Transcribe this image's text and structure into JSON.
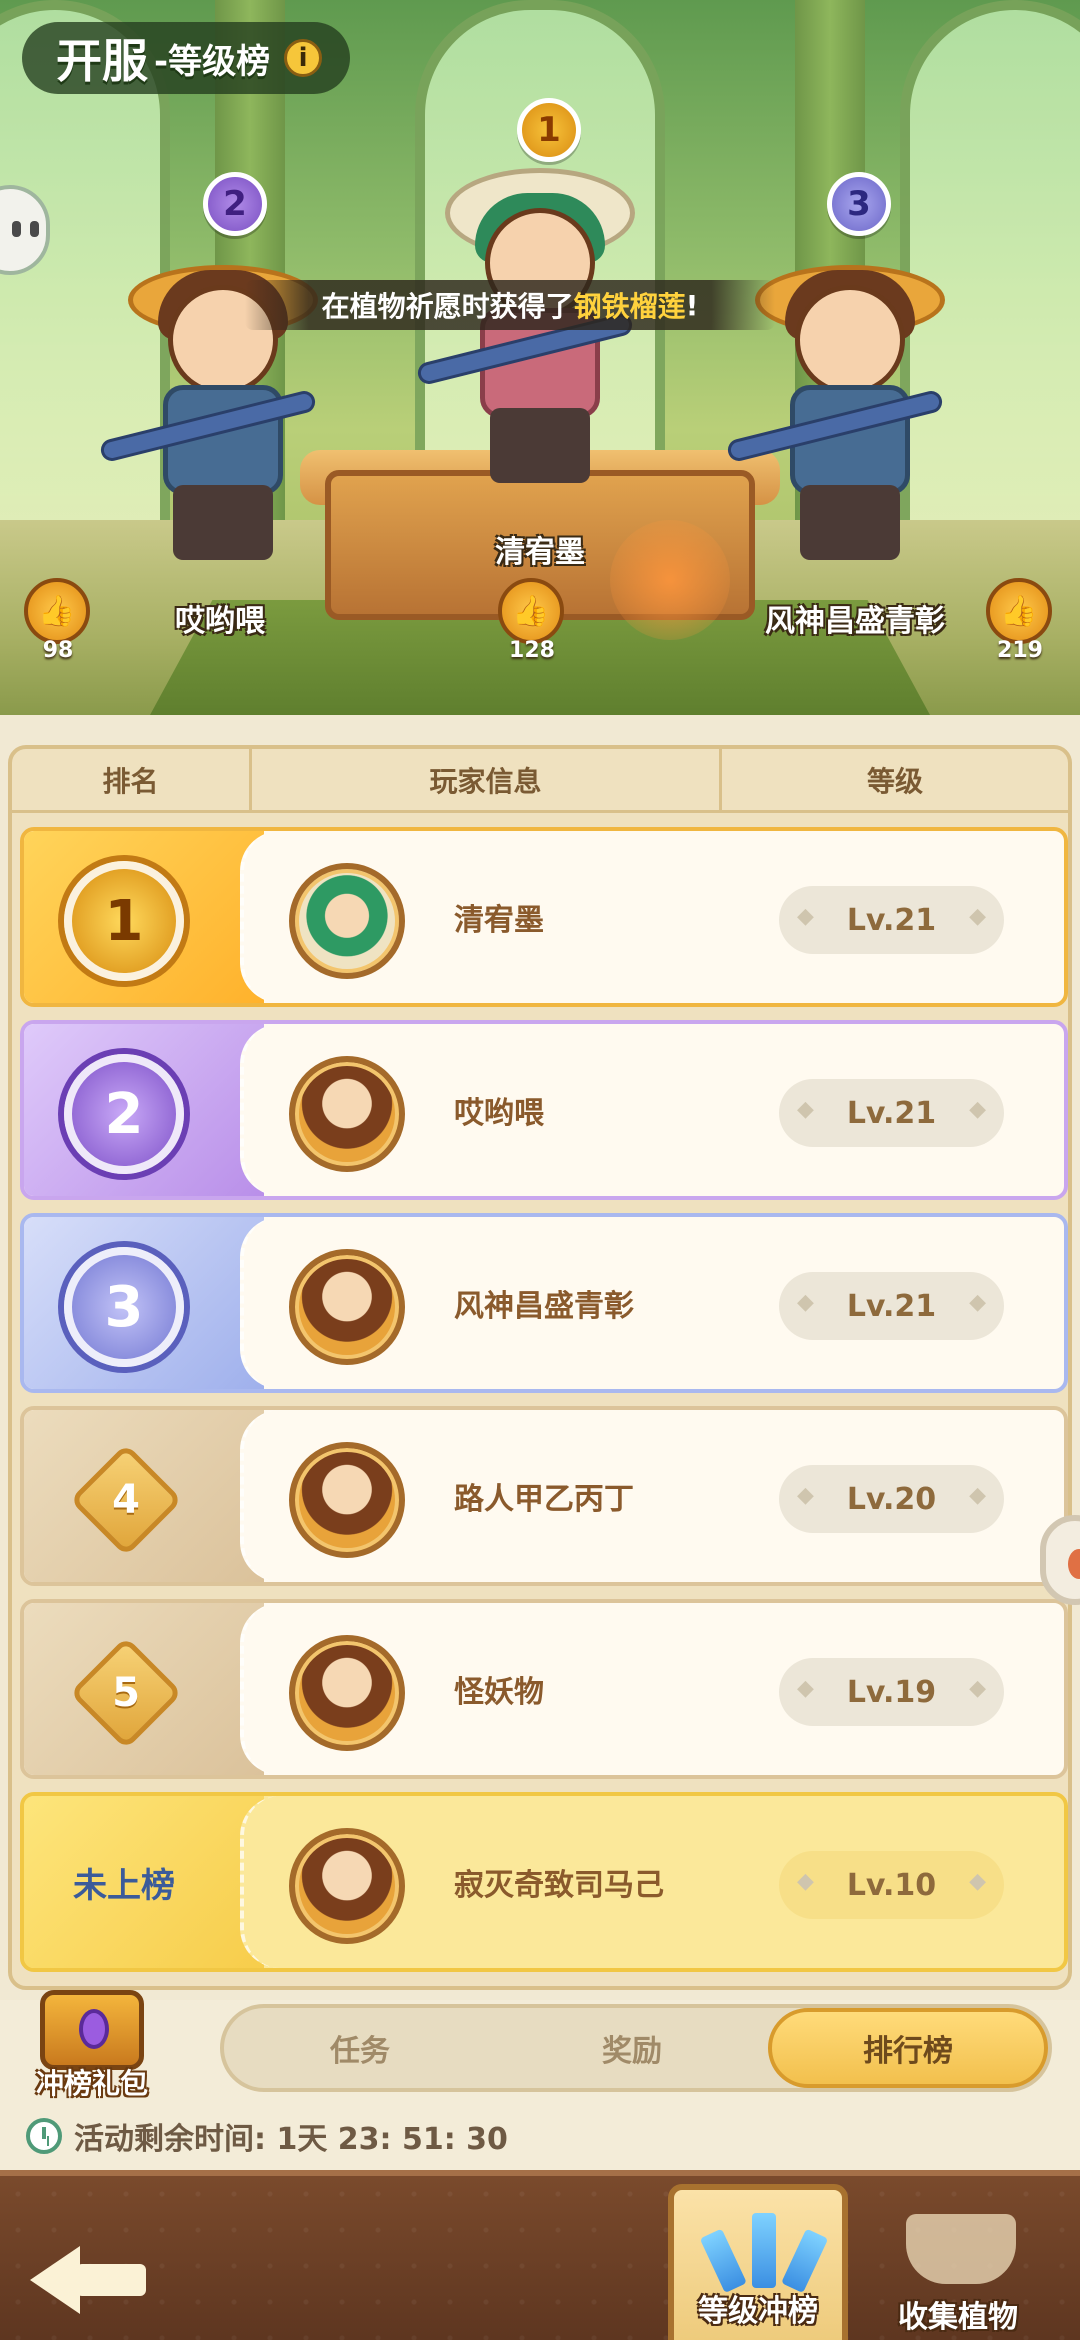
{
  "header": {
    "title_main": "开服",
    "title_sub": "-等级榜",
    "info_icon": "info-icon"
  },
  "toast": {
    "prefix": "在植物祈愿时获得了",
    "highlight": "钢铁榴莲",
    "suffix": "!"
  },
  "podium": [
    {
      "rank": "2",
      "name": "哎哟喂",
      "likes": "98",
      "medal_color": "purple"
    },
    {
      "rank": "1",
      "name": "清宥墨",
      "likes": "128",
      "medal_color": "gold"
    },
    {
      "rank": "3",
      "name": "风神昌盛青彰",
      "likes": "219",
      "medal_color": "blue"
    }
  ],
  "table": {
    "headers": [
      "排名",
      "玩家信息",
      "等级"
    ],
    "rows": [
      {
        "rank": "1",
        "name": "清宥墨",
        "level": "Lv.21"
      },
      {
        "rank": "2",
        "name": "哎哟喂",
        "level": "Lv.21"
      },
      {
        "rank": "3",
        "name": "风神昌盛青彰",
        "level": "Lv.21"
      },
      {
        "rank": "4",
        "name": "路人甲乙丙丁",
        "level": "Lv.20"
      },
      {
        "rank": "5",
        "name": "怪妖物",
        "level": "Lv.19"
      }
    ],
    "self": {
      "rank_label": "未上榜",
      "name": "寂灭奇致司马己",
      "level": "Lv.10"
    }
  },
  "gift": {
    "label": "冲榜礼包"
  },
  "tabs": [
    {
      "label": "任务",
      "active": false
    },
    {
      "label": "奖励",
      "active": false
    },
    {
      "label": "排行榜",
      "active": true
    }
  ],
  "timer": {
    "text": "活动剩余时间: 1天 23: 51: 30"
  },
  "nav": {
    "tabs": [
      {
        "label": "等级冲榜",
        "active": true
      },
      {
        "label": "收集植物",
        "active": false
      }
    ]
  },
  "colors": {
    "gold": "#f2c04d",
    "purple": "#b98fe9",
    "blue": "#9fb0ec",
    "brown": "#8a5a2c"
  }
}
